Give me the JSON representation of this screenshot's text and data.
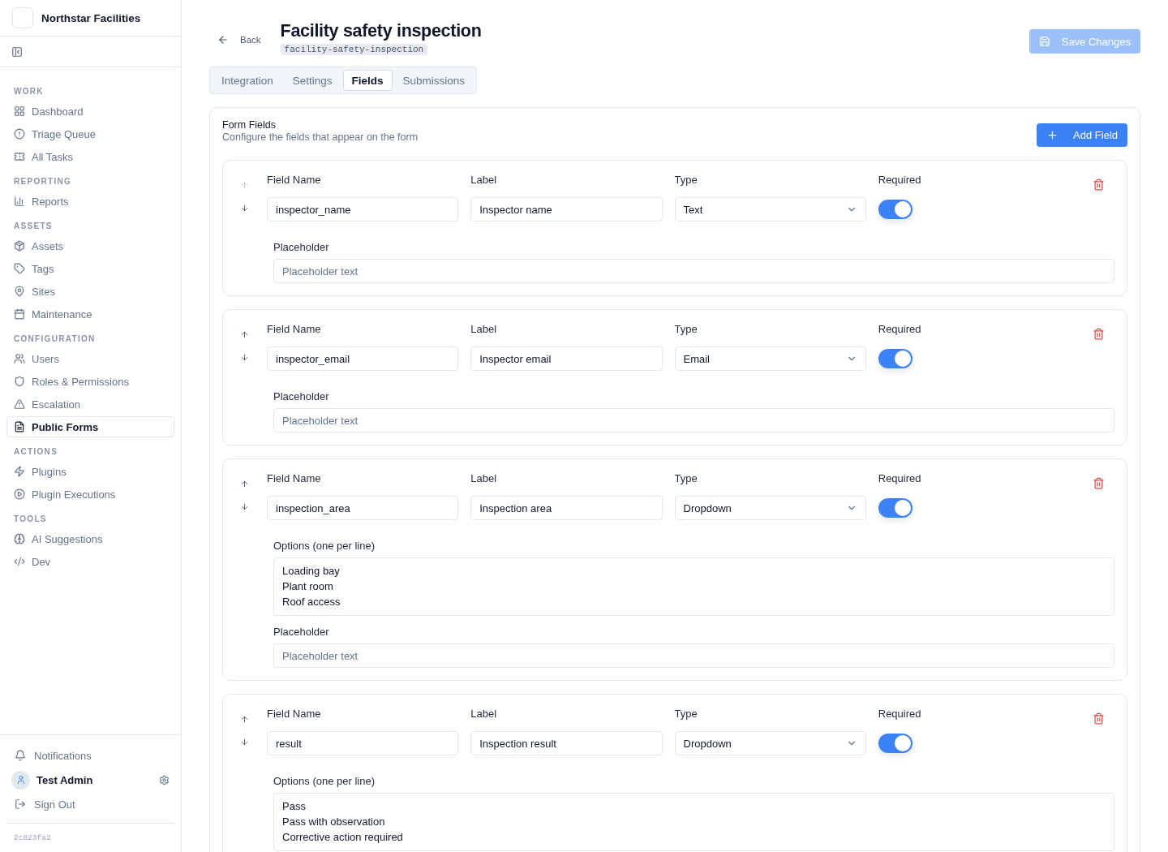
{
  "sidebar": {
    "brand": "Northstar Facilities",
    "sections": [
      {
        "heading": "WORK",
        "items": [
          {
            "label": "Dashboard",
            "selected": false
          },
          {
            "label": "Triage Queue",
            "selected": false
          },
          {
            "label": "All Tasks",
            "selected": false
          }
        ]
      },
      {
        "heading": "REPORTING",
        "items": [
          {
            "label": "Reports",
            "selected": false
          }
        ]
      },
      {
        "heading": "ASSETS",
        "items": [
          {
            "label": "Assets",
            "selected": false
          },
          {
            "label": "Tags",
            "selected": false
          },
          {
            "label": "Sites",
            "selected": false
          },
          {
            "label": "Maintenance",
            "selected": false
          }
        ]
      },
      {
        "heading": "CONFIGURATION",
        "items": [
          {
            "label": "Users",
            "selected": false
          },
          {
            "label": "Roles & Permissions",
            "selected": false
          },
          {
            "label": "Escalation",
            "selected": false
          },
          {
            "label": "Public Forms",
            "selected": true
          }
        ]
      },
      {
        "heading": "ACTIONS",
        "items": [
          {
            "label": "Plugins",
            "selected": false
          },
          {
            "label": "Plugin Executions",
            "selected": false
          }
        ]
      },
      {
        "heading": "TOOLS",
        "items": [
          {
            "label": "AI Suggestions",
            "selected": false
          },
          {
            "label": "Dev",
            "selected": false
          }
        ]
      }
    ],
    "notifications": "Notifications",
    "user": "Test Admin",
    "sign_out": "Sign Out",
    "version": "2c823fa2"
  },
  "header": {
    "back": "Back",
    "title": "Facility safety inspection",
    "slug": "facility-safety-inspection",
    "save": {
      "label": "Save Changes",
      "disabled": true
    }
  },
  "tabs": [
    {
      "label": "Integration",
      "selected": false
    },
    {
      "label": "Settings",
      "selected": false
    },
    {
      "label": "Fields",
      "selected": true
    },
    {
      "label": "Submissions",
      "selected": false
    }
  ],
  "form_fields": {
    "title": "Form Fields",
    "subtitle": "Configure the fields that appear on the form",
    "add": "Add Field",
    "fields": [
      {
        "up_disabled": true,
        "name_heading": "Field Name",
        "name": "inspector_name",
        "label_heading": "Label",
        "label": "Inspector name",
        "type_heading": "Type",
        "type": "Text",
        "required_heading": "Required",
        "required": true,
        "placeholder_heading": "Placeholder",
        "placeholder": "Placeholder text"
      },
      {
        "up_disabled": false,
        "name_heading": "Field Name",
        "name": "inspector_email",
        "label_heading": "Label",
        "label": "Inspector email",
        "type_heading": "Type",
        "type": "Email",
        "required_heading": "Required",
        "required": true,
        "placeholder_heading": "Placeholder",
        "placeholder": "Placeholder text"
      },
      {
        "up_disabled": false,
        "name_heading": "Field Name",
        "name": "inspection_area",
        "label_heading": "Label",
        "label": "Inspection area",
        "type_heading": "Type",
        "type": "Dropdown",
        "required_heading": "Required",
        "required": true,
        "options_heading": "Options (one per line)",
        "options": [
          "Loading bay",
          "Plant room",
          "Roof access"
        ],
        "placeholder_heading": "Placeholder",
        "placeholder": "Placeholder text"
      },
      {
        "up_disabled": false,
        "name_heading": "Field Name",
        "name": "result",
        "label_heading": "Label",
        "label": "Inspection result",
        "type_heading": "Type",
        "type": "Dropdown",
        "required_heading": "Required",
        "required": true,
        "options_heading": "Options (one per line)",
        "options": [
          "Pass",
          "Pass with observation",
          "Corrective action required"
        ]
      }
    ]
  }
}
